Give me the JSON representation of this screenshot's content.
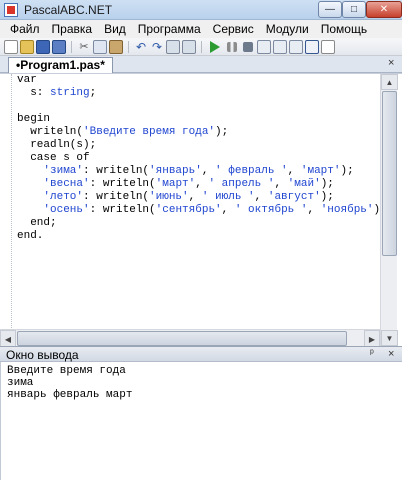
{
  "window": {
    "title": "PascalABC.NET",
    "buttons": {
      "minimize": "—",
      "maximize": "□",
      "close": "✕"
    }
  },
  "menu": {
    "items": [
      "Файл",
      "Правка",
      "Вид",
      "Программа",
      "Сервис",
      "Модули",
      "Помощь"
    ]
  },
  "toolbar": {
    "icons": [
      "new-file-icon",
      "open-file-icon",
      "save-icon",
      "save-all-icon",
      "cut-icon",
      "copy-icon",
      "paste-icon",
      "undo-icon",
      "redo-icon",
      "find-icon",
      "replace-icon",
      "run-icon",
      "pause-icon",
      "stop-icon",
      "step-over-icon",
      "step-into-icon",
      "step-out-icon",
      "output-window-icon",
      "new-window-icon"
    ]
  },
  "editor": {
    "tab_label": "•Program1.pas*",
    "tab_close": "×",
    "lines": [
      [
        {
          "t": "var",
          "c": "kw"
        }
      ],
      [
        {
          "t": "  s: ",
          "c": "plain"
        },
        {
          "t": "string",
          "c": "ty"
        },
        {
          "t": ";",
          "c": "plain"
        }
      ],
      [],
      [
        {
          "t": "begin",
          "c": "kw"
        }
      ],
      [
        {
          "t": "  writeln(",
          "c": "plain"
        },
        {
          "t": "'Введите время года'",
          "c": "str"
        },
        {
          "t": ");",
          "c": "plain"
        }
      ],
      [
        {
          "t": "  readln(s);",
          "c": "plain"
        }
      ],
      [
        {
          "t": "  case s of",
          "c": "plain"
        }
      ],
      [
        {
          "t": "    ",
          "c": "plain"
        },
        {
          "t": "'зима'",
          "c": "str"
        },
        {
          "t": ": writeln(",
          "c": "plain"
        },
        {
          "t": "'январь'",
          "c": "str"
        },
        {
          "t": ", ",
          "c": "plain"
        },
        {
          "t": "' февраль '",
          "c": "str"
        },
        {
          "t": ", ",
          "c": "plain"
        },
        {
          "t": "'март'",
          "c": "str"
        },
        {
          "t": ");",
          "c": "plain"
        }
      ],
      [
        {
          "t": "    ",
          "c": "plain"
        },
        {
          "t": "'весна'",
          "c": "str"
        },
        {
          "t": ": writeln(",
          "c": "plain"
        },
        {
          "t": "'март'",
          "c": "str"
        },
        {
          "t": ", ",
          "c": "plain"
        },
        {
          "t": "' апрель '",
          "c": "str"
        },
        {
          "t": ", ",
          "c": "plain"
        },
        {
          "t": "'май'",
          "c": "str"
        },
        {
          "t": ");",
          "c": "plain"
        }
      ],
      [
        {
          "t": "    ",
          "c": "plain"
        },
        {
          "t": "'лето'",
          "c": "str"
        },
        {
          "t": ": writeln(",
          "c": "plain"
        },
        {
          "t": "'июнь'",
          "c": "str"
        },
        {
          "t": ", ",
          "c": "plain"
        },
        {
          "t": "' июль '",
          "c": "str"
        },
        {
          "t": ", ",
          "c": "plain"
        },
        {
          "t": "'август'",
          "c": "str"
        },
        {
          "t": ");",
          "c": "plain"
        }
      ],
      [
        {
          "t": "    ",
          "c": "plain"
        },
        {
          "t": "'осень'",
          "c": "str"
        },
        {
          "t": ": writeln(",
          "c": "plain"
        },
        {
          "t": "'сентябрь'",
          "c": "str"
        },
        {
          "t": ", ",
          "c": "plain"
        },
        {
          "t": "' октябрь '",
          "c": "str"
        },
        {
          "t": ", ",
          "c": "plain"
        },
        {
          "t": "'ноябрь'",
          "c": "str"
        },
        {
          "t": ")",
          "c": "plain"
        }
      ],
      [
        {
          "t": "  end;",
          "c": "plain"
        }
      ],
      [
        {
          "t": "end.",
          "c": "kw"
        }
      ]
    ]
  },
  "output": {
    "title": "Окно вывода",
    "pin": "ᵖ",
    "close": "×",
    "lines": [
      "Введите время года",
      "зима",
      "январь февраль март"
    ]
  },
  "colors": {
    "keyword": "#000000",
    "string": "#2046d0",
    "type": "#2046d0"
  }
}
